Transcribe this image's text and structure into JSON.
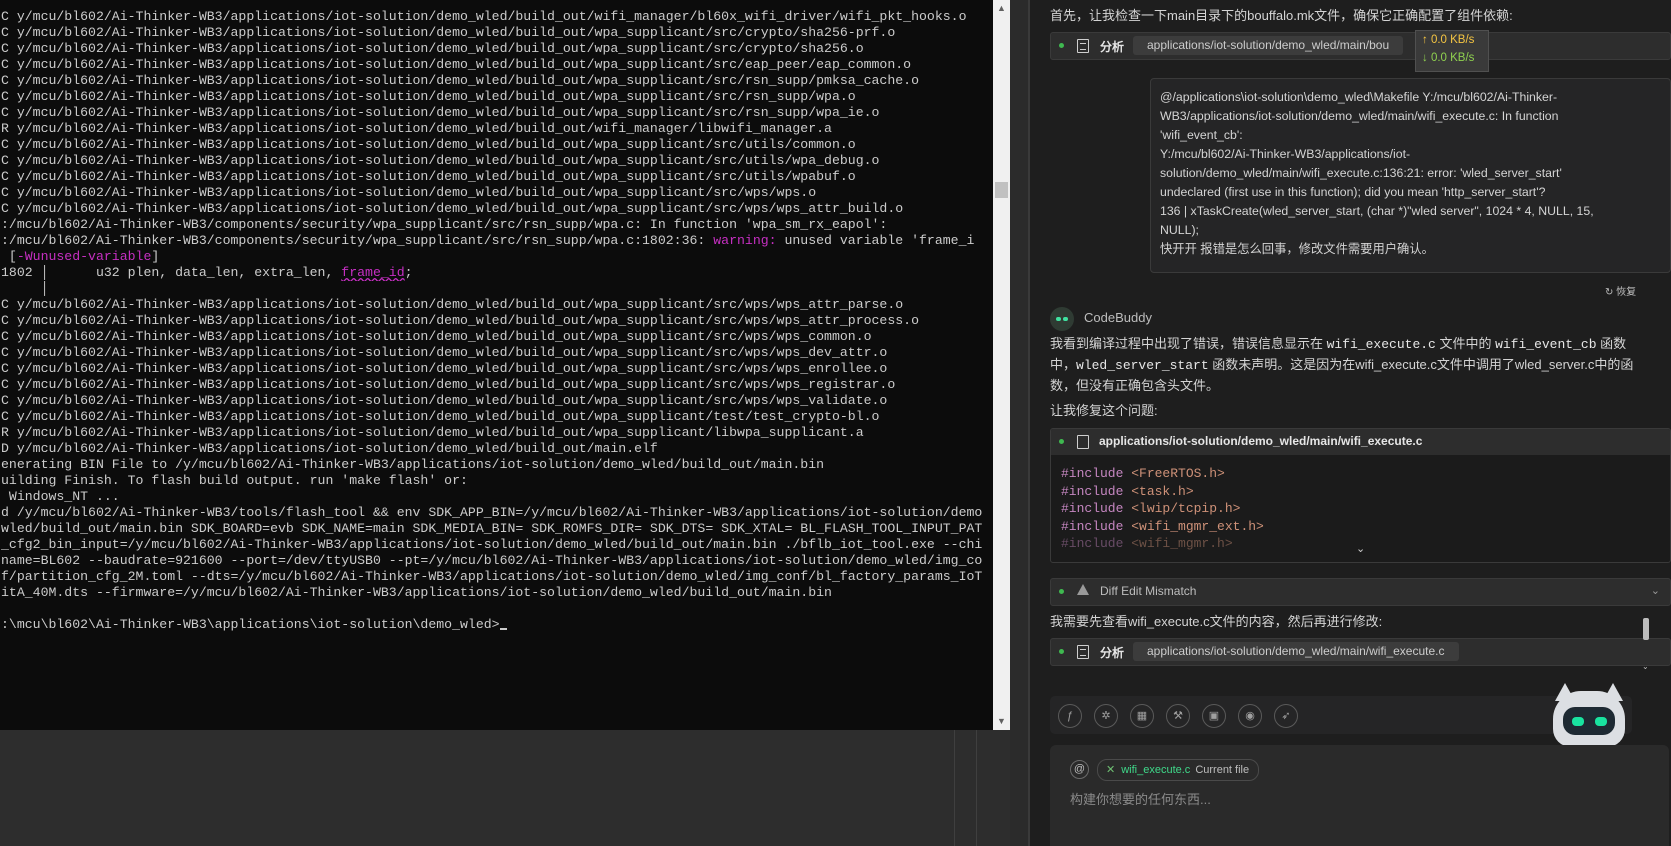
{
  "terminal": {
    "lines": [
      [
        {
          "t": "C y/mcu/bl602/Ai-Thinker-WB3/applications/iot-solution/demo_wled/build_out/wifi_manager/bl60x_wifi_driver/wifi_pkt_hooks.o"
        }
      ],
      [
        {
          "t": "C y/mcu/bl602/Ai-Thinker-WB3/applications/iot-solution/demo_wled/build_out/wpa_supplicant/src/crypto/sha256-prf.o"
        }
      ],
      [
        {
          "t": "C y/mcu/bl602/Ai-Thinker-WB3/applications/iot-solution/demo_wled/build_out/wpa_supplicant/src/crypto/sha256.o"
        }
      ],
      [
        {
          "t": "C y/mcu/bl602/Ai-Thinker-WB3/applications/iot-solution/demo_wled/build_out/wpa_supplicant/src/eap_peer/eap_common.o"
        }
      ],
      [
        {
          "t": "C y/mcu/bl602/Ai-Thinker-WB3/applications/iot-solution/demo_wled/build_out/wpa_supplicant/src/rsn_supp/pmksa_cache.o"
        }
      ],
      [
        {
          "t": "C y/mcu/bl602/Ai-Thinker-WB3/applications/iot-solution/demo_wled/build_out/wpa_supplicant/src/rsn_supp/wpa.o"
        }
      ],
      [
        {
          "t": "C y/mcu/bl602/Ai-Thinker-WB3/applications/iot-solution/demo_wled/build_out/wpa_supplicant/src/rsn_supp/wpa_ie.o"
        }
      ],
      [
        {
          "t": "R y/mcu/bl602/Ai-Thinker-WB3/applications/iot-solution/demo_wled/build_out/wifi_manager/libwifi_manager.a"
        }
      ],
      [
        {
          "t": "C y/mcu/bl602/Ai-Thinker-WB3/applications/iot-solution/demo_wled/build_out/wpa_supplicant/src/utils/common.o"
        }
      ],
      [
        {
          "t": "C y/mcu/bl602/Ai-Thinker-WB3/applications/iot-solution/demo_wled/build_out/wpa_supplicant/src/utils/wpa_debug.o"
        }
      ],
      [
        {
          "t": "C y/mcu/bl602/Ai-Thinker-WB3/applications/iot-solution/demo_wled/build_out/wpa_supplicant/src/utils/wpabuf.o"
        }
      ],
      [
        {
          "t": "C y/mcu/bl602/Ai-Thinker-WB3/applications/iot-solution/demo_wled/build_out/wpa_supplicant/src/wps/wps.o"
        }
      ],
      [
        {
          "t": "C y/mcu/bl602/Ai-Thinker-WB3/applications/iot-solution/demo_wled/build_out/wpa_supplicant/src/wps/wps_attr_build.o"
        }
      ],
      [
        {
          "t": ":/mcu/bl602/Ai-Thinker-WB3/components/security/wpa_supplicant/src/rsn_supp/wpa.c: In function 'wpa_sm_rx_eapol':"
        }
      ],
      [
        {
          "t": ":/mcu/bl602/Ai-Thinker-WB3/components/security/wpa_supplicant/src/rsn_supp/wpa.c:1802:36: "
        },
        {
          "t": "warning:",
          "c": "w"
        },
        {
          "t": " unused variable 'frame_i"
        }
      ],
      [
        {
          "t": " ["
        },
        {
          "t": "-Wunused-variable",
          "c": "w"
        },
        {
          "t": "]"
        }
      ],
      [
        {
          "t": "1802 │      u32 plen, data_len, extra_len, "
        },
        {
          "t": "frame_id",
          "c": "u"
        },
        {
          "t": ";"
        }
      ],
      [
        {
          "t": "     │"
        }
      ],
      [
        {
          "t": "C y/mcu/bl602/Ai-Thinker-WB3/applications/iot-solution/demo_wled/build_out/wpa_supplicant/src/wps/wps_attr_parse.o"
        }
      ],
      [
        {
          "t": "C y/mcu/bl602/Ai-Thinker-WB3/applications/iot-solution/demo_wled/build_out/wpa_supplicant/src/wps/wps_attr_process.o"
        }
      ],
      [
        {
          "t": "C y/mcu/bl602/Ai-Thinker-WB3/applications/iot-solution/demo_wled/build_out/wpa_supplicant/src/wps/wps_common.o"
        }
      ],
      [
        {
          "t": "C y/mcu/bl602/Ai-Thinker-WB3/applications/iot-solution/demo_wled/build_out/wpa_supplicant/src/wps/wps_dev_attr.o"
        }
      ],
      [
        {
          "t": "C y/mcu/bl602/Ai-Thinker-WB3/applications/iot-solution/demo_wled/build_out/wpa_supplicant/src/wps/wps_enrollee.o"
        }
      ],
      [
        {
          "t": "C y/mcu/bl602/Ai-Thinker-WB3/applications/iot-solution/demo_wled/build_out/wpa_supplicant/src/wps/wps_registrar.o"
        }
      ],
      [
        {
          "t": "C y/mcu/bl602/Ai-Thinker-WB3/applications/iot-solution/demo_wled/build_out/wpa_supplicant/src/wps/wps_validate.o"
        }
      ],
      [
        {
          "t": "C y/mcu/bl602/Ai-Thinker-WB3/applications/iot-solution/demo_wled/build_out/wpa_supplicant/test/test_crypto-bl.o"
        }
      ],
      [
        {
          "t": "R y/mcu/bl602/Ai-Thinker-WB3/applications/iot-solution/demo_wled/build_out/wpa_supplicant/libwpa_supplicant.a"
        }
      ],
      [
        {
          "t": "D y/mcu/bl602/Ai-Thinker-WB3/applications/iot-solution/demo_wled/build_out/main.elf"
        }
      ],
      [
        {
          "t": "enerating BIN File to /y/mcu/bl602/Ai-Thinker-WB3/applications/iot-solution/demo_wled/build_out/main.bin"
        }
      ],
      [
        {
          "t": "uilding Finish. To flash build output. run 'make flash' or:"
        }
      ],
      [
        {
          "t": " Windows_NT ..."
        }
      ],
      [
        {
          "t": "d /y/mcu/bl602/Ai-Thinker-WB3/tools/flash_tool && env SDK_APP_BIN=/y/mcu/bl602/Ai-Thinker-WB3/applications/iot-solution/demo"
        }
      ],
      [
        {
          "t": "wled/build_out/main.bin SDK_BOARD=evb SDK_NAME=main SDK_MEDIA_BIN= SDK_ROMFS_DIR= SDK_DTS= SDK_XTAL= BL_FLASH_TOOL_INPUT_PAT"
        }
      ],
      [
        {
          "t": "_cfg2_bin_input=/y/mcu/bl602/Ai-Thinker-WB3/applications/iot-solution/demo_wled/build_out/main.bin ./bflb_iot_tool.exe --chi"
        }
      ],
      [
        {
          "t": "name=BL602 --baudrate=921600 --port=/dev/ttyUSB0 --pt=/y/mcu/bl602/Ai-Thinker-WB3/applications/iot-solution/demo_wled/img_co"
        }
      ],
      [
        {
          "t": "f/partition_cfg_2M.toml --dts=/y/mcu/bl602/Ai-Thinker-WB3/applications/iot-solution/demo_wled/img_conf/bl_factory_params_IoT"
        }
      ],
      [
        {
          "t": "itA_40M.dts --firmware=/y/mcu/bl602/Ai-Thinker-WB3/applications/iot-solution/demo_wled/build_out/main.bin"
        }
      ],
      [
        {
          "t": ""
        }
      ],
      [
        {
          "t": ":\\mcu\\bl602\\Ai-Thinker-WB3\\applications\\iot-solution\\demo_wled>"
        },
        {
          "t": "",
          "c": "cur"
        }
      ]
    ]
  },
  "network_monitor": {
    "up": "↑ 0.0 KB/s",
    "down": "↓ 0.0 KB/s",
    "up_color": "#f5c542",
    "down_color": "#8fd14f"
  },
  "chat": {
    "intro": "首先，让我检查一下main目录下的bouffalo.mk文件，确保它正确配置了组件依赖:",
    "tool_label": "分析",
    "analyze1_path": "applications/iot-solution/demo_wled/main/bou",
    "user_message_lines": [
      "@/applications\\iot-solution\\demo_wled\\Makefile Y:/mcu/bl602/Ai-Thinker-",
      "WB3/applications/iot-solution/demo_wled/main/wifi_execute.c: In function",
      "'wifi_event_cb':",
      "Y:/mcu/bl602/Ai-Thinker-WB3/applications/iot-",
      "solution/demo_wled/main/wifi_execute.c:136:21: error: 'wled_server_start'",
      "undeclared (first use in this function); did you mean 'http_server_start'?",
      "136 | xTaskCreate(wled_server_start, (char *)\"wled server\", 1024 * 4, NULL, 15,",
      "NULL);",
      "快开开 报错是怎么回事，修改文件需要用户确认。"
    ],
    "restore_label": "恢复",
    "bot_name": "CodeBuddy",
    "reply_p1_a": "我看到编译过程中出现了错误，错误信息显示在 ",
    "reply_p1_code1": "wifi_execute.c",
    "reply_p1_b": " 文件中的 ",
    "reply_p1_code2": "wifi_event_cb",
    "reply_p1_c": " 函数",
    "reply_p2_a": "中，",
    "reply_p2_code": "wled_server_start",
    "reply_p2_b": " 函数未声明。这是因为在wifi_execute.c文件中调用了wled_server.c中的函",
    "reply_p3": "数，但没有正确包含头文件。",
    "fix_intro": "让我修复这个问题:",
    "code_file": "applications/iot-solution/demo_wled/main/wifi_execute.c",
    "code_lines": [
      {
        "kw": "#include",
        "inc": " <FreeRTOS.h>"
      },
      {
        "kw": "#include",
        "inc": " <task.h>"
      },
      {
        "kw": "#include",
        "inc": " <lwip/tcpip.h>"
      },
      {
        "kw": "#include",
        "inc": " <wifi_mgmr_ext.h>"
      },
      {
        "kw": "#include",
        "inc": " <wifi_mgmr.h>"
      }
    ],
    "diff_label": "Diff Edit Mismatch",
    "followup": "我需要先查看wifi_execute.c文件的内容，然后再进行修改:",
    "analyze2_path": "applications/iot-solution/demo_wled/main/wifi_execute.c",
    "input": {
      "chip_file": "wifi_execute.c",
      "chip_tag": "Current file",
      "placeholder": "构建你想要的任何东西..."
    },
    "toolbar_icons": [
      "figma-icon",
      "sparkle-icon",
      "blocks-icon",
      "wand-icon",
      "image-icon",
      "eye-icon",
      "rocket-icon"
    ]
  }
}
